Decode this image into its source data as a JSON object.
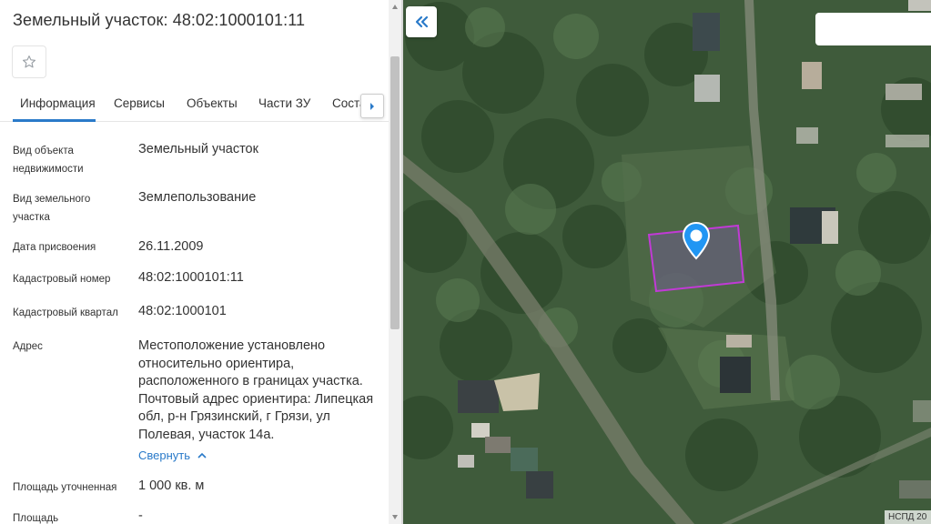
{
  "panel": {
    "title": "Земельный участок: 48:02:1000101:11",
    "tabs": [
      {
        "label": "Информация"
      },
      {
        "label": "Сервисы"
      },
      {
        "label": "Объекты"
      },
      {
        "label": "Части ЗУ"
      },
      {
        "label": "Состав"
      }
    ],
    "rows": [
      {
        "label": "Вид объекта недвижимости",
        "value": "Земельный участок"
      },
      {
        "label": "Вид земельного участка",
        "value": "Землепользование"
      },
      {
        "label": "Дата присвоения",
        "value": "26.11.2009"
      },
      {
        "label": "Кадастровый номер",
        "value": "48:02:1000101:11"
      },
      {
        "label": "Кадастровый квартал",
        "value": "48:02:1000101"
      },
      {
        "label": "Адрес",
        "value": "Местоположение установлено относительно ориентира, расположенного в границах участка. Почтовый адрес ориентира: Липецкая обл, р-н Грязинский, г Грязи, ул Полевая, участок 14а."
      },
      {
        "label": "Площадь уточненная",
        "value": "1 000 кв. м"
      },
      {
        "label": "Площадь",
        "value": "-"
      }
    ],
    "collapse_link": "Свернуть"
  },
  "map": {
    "credit": "НСПД 20",
    "marker_color": "#2196f3",
    "parcel_color": "#c13ad6"
  },
  "icons": {
    "favorite": "star-outline-icon",
    "tabs_next": "chevron-right-icon",
    "collapse": "chevron-up-icon",
    "hide_panel": "double-chevron-left-icon",
    "marker": "map-pin-icon"
  }
}
